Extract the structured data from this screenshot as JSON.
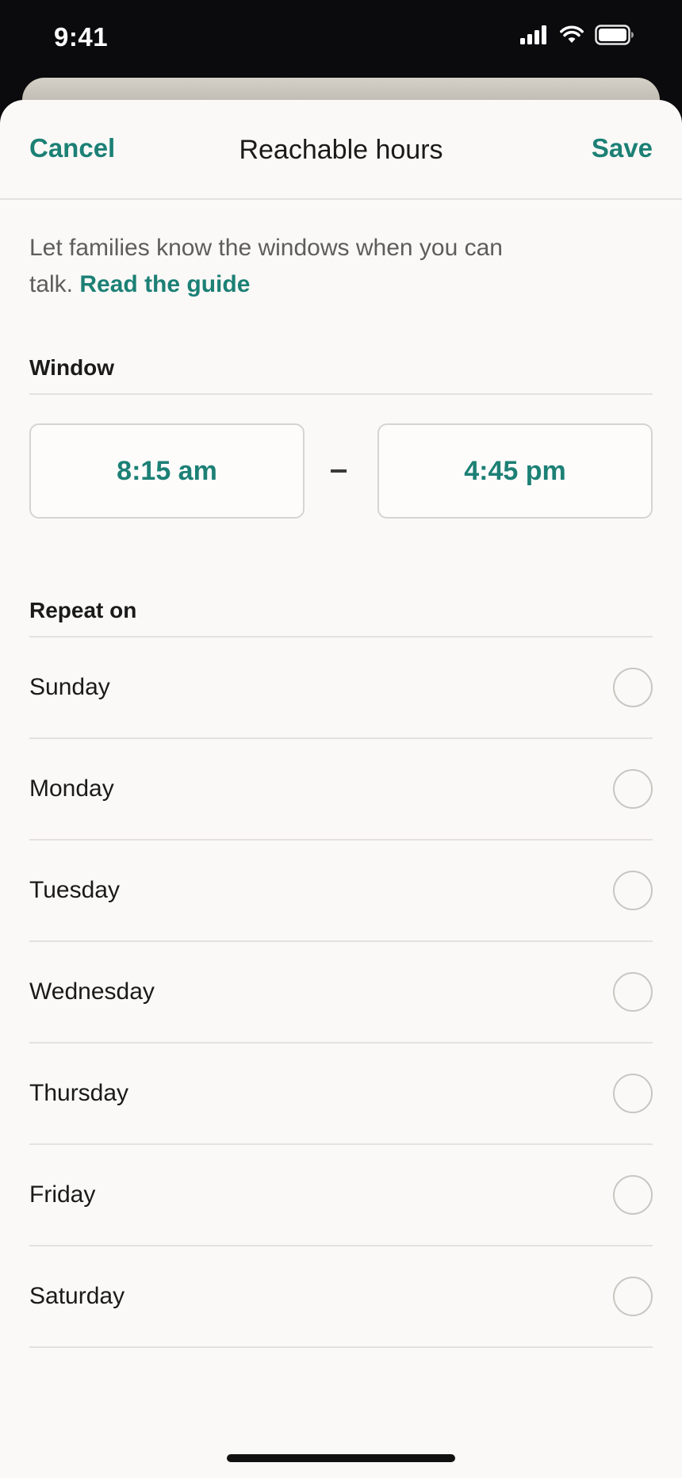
{
  "status_bar": {
    "time": "9:41",
    "icons": [
      "cellular-signal-icon",
      "wifi-icon",
      "battery-icon"
    ]
  },
  "nav": {
    "cancel_label": "Cancel",
    "title": "Reachable hours",
    "save_label": "Save"
  },
  "intro": {
    "text": "Let families know the windows when you can talk.",
    "link_label": "Read the guide"
  },
  "window": {
    "label": "Window",
    "start_time": "8:15 am",
    "end_time": "4:45 pm"
  },
  "repeat": {
    "label": "Repeat on",
    "days": [
      {
        "label": "Sunday",
        "checked": false
      },
      {
        "label": "Monday",
        "checked": false
      },
      {
        "label": "Tuesday",
        "checked": false
      },
      {
        "label": "Wednesday",
        "checked": false
      },
      {
        "label": "Thursday",
        "checked": false
      },
      {
        "label": "Friday",
        "checked": false
      },
      {
        "label": "Saturday",
        "checked": false
      }
    ]
  },
  "colors": {
    "accent": "#1c8075",
    "sheet_background": "#faf9f7",
    "divider": "#e4e2de"
  }
}
